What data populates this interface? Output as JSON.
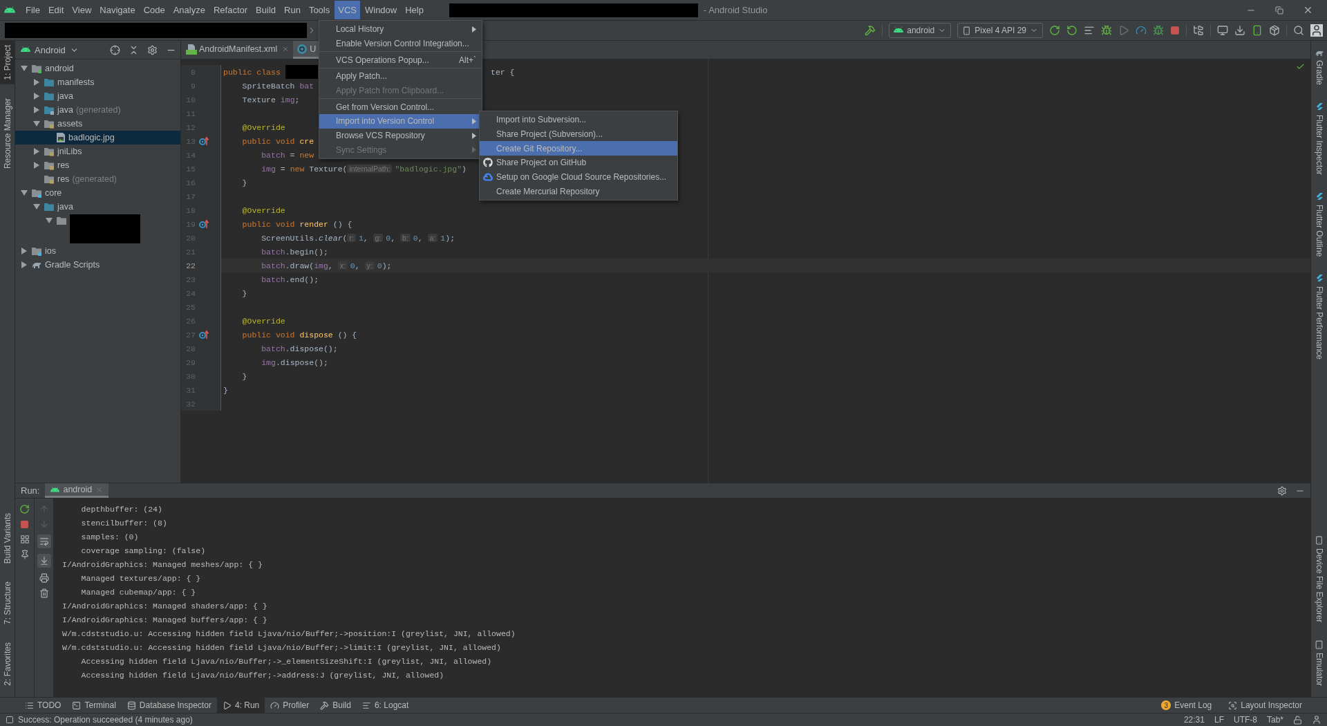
{
  "title_bar": {
    "title": "- Android Studio"
  },
  "menu_bar": [
    {
      "label": "File",
      "selected": false
    },
    {
      "label": "Edit",
      "selected": false
    },
    {
      "label": "View",
      "selected": false
    },
    {
      "label": "Navigate",
      "selected": false
    },
    {
      "label": "Code",
      "selected": false
    },
    {
      "label": "Analyze",
      "selected": false
    },
    {
      "label": "Refactor",
      "selected": false
    },
    {
      "label": "Build",
      "selected": false
    },
    {
      "label": "Run",
      "selected": false
    },
    {
      "label": "Tools",
      "selected": false
    },
    {
      "label": "VCS",
      "selected": true
    },
    {
      "label": "Window",
      "selected": false
    },
    {
      "label": "Help",
      "selected": false
    }
  ],
  "toolbar": {
    "run_config": "android",
    "device": "Pixel 4 API 29"
  },
  "left_tool_strip": {
    "top": [
      {
        "label": "1: Project",
        "selected": true
      },
      {
        "label": "Resource Manager",
        "selected": false
      }
    ],
    "bottom": [
      {
        "label": "Build Variants",
        "selected": false
      },
      {
        "label": "7: Structure",
        "selected": false
      },
      {
        "label": "2: Favorites",
        "selected": false
      }
    ]
  },
  "project_panel": {
    "view": "Android",
    "tree": [
      {
        "kind": "android-module",
        "label": "android",
        "expandable": true,
        "expanded": true,
        "selected": false,
        "children": [
          {
            "kind": "folder",
            "label": "manifests",
            "expandable": true,
            "expanded": false,
            "selected": false
          },
          {
            "kind": "folder",
            "label": "java",
            "expandable": true,
            "expanded": false,
            "selected": false
          },
          {
            "kind": "folder-generated",
            "label": "java",
            "note": "(generated)",
            "expandable": true,
            "expanded": false,
            "selected": false
          },
          {
            "kind": "res-folder",
            "label": "assets",
            "expandable": true,
            "expanded": true,
            "selected": false,
            "children": [
              {
                "kind": "image",
                "label": "badlogic.jpg",
                "expandable": false,
                "expanded": false,
                "selected": true
              }
            ]
          },
          {
            "kind": "res-folder",
            "label": "jniLibs",
            "expandable": true,
            "expanded": false,
            "selected": false
          },
          {
            "kind": "res-folder",
            "label": "res",
            "expandable": true,
            "expanded": false,
            "selected": false
          },
          {
            "kind": "res-folder",
            "label": "res",
            "note": "(generated)",
            "expandable": false,
            "expanded": false,
            "selected": false
          }
        ]
      },
      {
        "kind": "module",
        "label": "core",
        "expandable": true,
        "expanded": true,
        "selected": false,
        "children": [
          {
            "kind": "folder",
            "label": "java",
            "expandable": true,
            "expanded": true,
            "selected": false,
            "children": [
              {
                "kind": "package",
                "redacted": true,
                "expandable": true,
                "expanded": true,
                "selected": false
              }
            ]
          }
        ]
      },
      {
        "kind": "module",
        "label": "ios",
        "expandable": true,
        "expanded": false,
        "selected": false
      },
      {
        "kind": "gradle",
        "label": "Gradle Scripts",
        "expandable": true,
        "expanded": false,
        "selected": false
      }
    ]
  },
  "editor": {
    "tabs": [
      {
        "kind": "manifest",
        "label": "AndroidManifest.xml",
        "closable": true,
        "selected": false
      },
      {
        "kind": "class",
        "label": "U",
        "closable": false,
        "selected": true
      }
    ],
    "lines": [
      {
        "number": "8",
        "current": false,
        "override": false,
        "left": [
          {
            "kind": "kw",
            "text": "public class "
          },
          {
            "kind": "redacted"
          }
        ],
        "right": [
          {
            "kind": "plain",
            "text": "ter {"
          }
        ]
      },
      {
        "number": "9",
        "current": false,
        "override": false,
        "left": [
          {
            "kind": "plain",
            "text": "    SpriteBatch "
          },
          {
            "kind": "field",
            "text": "bat"
          }
        ]
      },
      {
        "number": "10",
        "current": false,
        "override": false,
        "left": [
          {
            "kind": "plain",
            "text": "    Texture "
          },
          {
            "kind": "field",
            "text": "img"
          },
          {
            "kind": "plain",
            "text": ";"
          }
        ]
      },
      {
        "number": "11",
        "current": false,
        "override": false
      },
      {
        "number": "12",
        "current": false,
        "override": false,
        "left": [
          {
            "kind": "annot",
            "text": "    @Override"
          }
        ]
      },
      {
        "number": "13",
        "current": false,
        "override": true,
        "left": [
          {
            "kind": "kw",
            "text": "    public void "
          },
          {
            "kind": "fn",
            "text": "cre"
          }
        ]
      },
      {
        "number": "14",
        "current": false,
        "override": false,
        "left": [
          {
            "kind": "field",
            "text": "        batch"
          },
          {
            "kind": "plain",
            "text": " = "
          },
          {
            "kind": "kw",
            "text": "new"
          }
        ]
      },
      {
        "number": "15",
        "current": false,
        "override": false,
        "left": [
          {
            "kind": "field",
            "text": "        img"
          },
          {
            "kind": "plain",
            "text": " = "
          },
          {
            "kind": "kw",
            "text": "new "
          },
          {
            "kind": "plain",
            "text": "Texture("
          },
          {
            "kind": "hint",
            "text": "internalPath:"
          },
          {
            "kind": "str",
            "text": "\"badlogic.jpg\""
          },
          {
            "kind": "plain",
            "text": ")"
          }
        ]
      },
      {
        "number": "16",
        "current": false,
        "override": false,
        "left": [
          {
            "kind": "plain",
            "text": "    }"
          }
        ]
      },
      {
        "number": "17",
        "current": false,
        "override": false
      },
      {
        "number": "18",
        "current": false,
        "override": false,
        "left": [
          {
            "kind": "annot",
            "text": "    @Override"
          }
        ]
      },
      {
        "number": "19",
        "current": false,
        "override": true,
        "left": [
          {
            "kind": "kw",
            "text": "    public void "
          },
          {
            "kind": "fn",
            "text": "render "
          },
          {
            "kind": "plain",
            "text": "() {"
          }
        ]
      },
      {
        "number": "20",
        "current": false,
        "override": false,
        "left": [
          {
            "kind": "plain",
            "text": "        ScreenUtils."
          },
          {
            "kind": "static",
            "text": "clear"
          },
          {
            "kind": "plain",
            "text": "("
          },
          {
            "kind": "hint",
            "text": "r:"
          },
          {
            "kind": "num",
            "text": "1"
          },
          {
            "kind": "plain",
            "text": ", "
          },
          {
            "kind": "hint",
            "text": "g:"
          },
          {
            "kind": "num",
            "text": "0"
          },
          {
            "kind": "plain",
            "text": ", "
          },
          {
            "kind": "hint",
            "text": "b:"
          },
          {
            "kind": "num",
            "text": "0"
          },
          {
            "kind": "plain",
            "text": ", "
          },
          {
            "kind": "hint",
            "text": "a:"
          },
          {
            "kind": "num",
            "text": "1"
          },
          {
            "kind": "plain",
            "text": ");"
          }
        ]
      },
      {
        "number": "21",
        "current": false,
        "override": false,
        "left": [
          {
            "kind": "field",
            "text": "        batch"
          },
          {
            "kind": "plain",
            "text": ".begin();"
          }
        ]
      },
      {
        "number": "22",
        "current": true,
        "override": false,
        "left": [
          {
            "kind": "field",
            "text": "        batch"
          },
          {
            "kind": "plain",
            "text": ".draw("
          },
          {
            "kind": "field",
            "text": "img"
          },
          {
            "kind": "plain",
            "text": ", "
          },
          {
            "kind": "hint",
            "text": "x:"
          },
          {
            "kind": "num",
            "text": "0"
          },
          {
            "kind": "plain",
            "text": ", "
          },
          {
            "kind": "hint",
            "text": "y:"
          },
          {
            "kind": "num",
            "text": "0"
          },
          {
            "kind": "plain",
            "text": ");"
          }
        ]
      },
      {
        "number": "23",
        "current": false,
        "override": false,
        "left": [
          {
            "kind": "field",
            "text": "        batch"
          },
          {
            "kind": "plain",
            "text": ".end();"
          }
        ]
      },
      {
        "number": "24",
        "current": false,
        "override": false,
        "left": [
          {
            "kind": "plain",
            "text": "    }"
          }
        ]
      },
      {
        "number": "25",
        "current": false,
        "override": false
      },
      {
        "number": "26",
        "current": false,
        "override": false,
        "left": [
          {
            "kind": "annot",
            "text": "    @Override"
          }
        ]
      },
      {
        "number": "27",
        "current": false,
        "override": true,
        "left": [
          {
            "kind": "kw",
            "text": "    public void "
          },
          {
            "kind": "fn",
            "text": "dispose "
          },
          {
            "kind": "plain",
            "text": "() {"
          }
        ]
      },
      {
        "number": "28",
        "current": false,
        "override": false,
        "left": [
          {
            "kind": "field",
            "text": "        batch"
          },
          {
            "kind": "plain",
            "text": ".dispose();"
          }
        ]
      },
      {
        "number": "29",
        "current": false,
        "override": false,
        "left": [
          {
            "kind": "field",
            "text": "        img"
          },
          {
            "kind": "plain",
            "text": ".dispose();"
          }
        ]
      },
      {
        "number": "30",
        "current": false,
        "override": false,
        "left": [
          {
            "kind": "plain",
            "text": "    }"
          }
        ]
      },
      {
        "number": "31",
        "current": false,
        "override": false,
        "left": [
          {
            "kind": "plain",
            "text": "}"
          }
        ]
      },
      {
        "number": "32",
        "current": false,
        "override": false
      }
    ]
  },
  "vcs_menu": {
    "items": [
      {
        "kind": "item",
        "label": "Local History",
        "submenu": true,
        "disabled": false,
        "selected": false
      },
      {
        "kind": "item",
        "label": "Enable Version Control Integration...",
        "submenu": false,
        "disabled": false,
        "selected": false
      },
      {
        "kind": "separator"
      },
      {
        "kind": "item",
        "label": "VCS Operations Popup...",
        "shortcut": "Alt+`",
        "submenu": false,
        "disabled": false,
        "selected": false
      },
      {
        "kind": "separator"
      },
      {
        "kind": "item",
        "label": "Apply Patch...",
        "submenu": false,
        "disabled": false,
        "selected": false
      },
      {
        "kind": "item",
        "label": "Apply Patch from Clipboard...",
        "submenu": false,
        "disabled": true,
        "selected": false
      },
      {
        "kind": "separator"
      },
      {
        "kind": "item",
        "label": "Get from Version Control...",
        "submenu": false,
        "disabled": false,
        "selected": false
      },
      {
        "kind": "item",
        "label": "Import into Version Control",
        "submenu": true,
        "disabled": false,
        "selected": true
      },
      {
        "kind": "item",
        "label": "Browse VCS Repository",
        "submenu": true,
        "disabled": false,
        "selected": false
      },
      {
        "kind": "item",
        "label": "Sync Settings",
        "submenu": true,
        "disabled": true,
        "selected": false
      }
    ]
  },
  "import_submenu": {
    "items": [
      {
        "kind": "plain",
        "label": "Import into Subversion...",
        "selected": false
      },
      {
        "kind": "plain",
        "label": "Share Project (Subversion)...",
        "selected": false
      },
      {
        "kind": "plain",
        "label": "Create Git Repository...",
        "selected": true
      },
      {
        "kind": "github",
        "label": "Share Project on GitHub",
        "selected": false
      },
      {
        "kind": "gcloud",
        "label": "Setup on Google Cloud Source Repositories...",
        "selected": false
      },
      {
        "kind": "plain",
        "label": "Create Mercurial Repository",
        "selected": false
      }
    ]
  },
  "run_panel": {
    "label": "Run:",
    "tabs": [
      {
        "label": "android",
        "selected": true
      }
    ],
    "console": [
      "    depthbuffer: (24)",
      "    stencilbuffer: (8)",
      "    samples: (0)",
      "    coverage sampling: (false)",
      "I/AndroidGraphics: Managed meshes/app: { }",
      "    Managed textures/app: { }",
      "    Managed cubemap/app: { }",
      "I/AndroidGraphics: Managed shaders/app: { }",
      "I/AndroidGraphics: Managed buffers/app: { }",
      "W/m.cdststudio.u: Accessing hidden field Ljava/nio/Buffer;->position:I (greylist, JNI, allowed)",
      "W/m.cdststudio.u: Accessing hidden field Ljava/nio/Buffer;->limit:I (greylist, JNI, allowed)",
      "    Accessing hidden field Ljava/nio/Buffer;->_elementSizeShift:I (greylist, JNI, allowed)",
      "    Accessing hidden field Ljava/nio/Buffer;->address:J (greylist, JNI, allowed)"
    ]
  },
  "right_tool_strip": {
    "top": [
      {
        "kind": "gradle",
        "label": "Gradle"
      },
      {
        "kind": "flutter",
        "label": "Flutter Inspector"
      },
      {
        "kind": "flutter",
        "label": "Flutter Outline"
      },
      {
        "kind": "flutter",
        "label": "Flutter Performance"
      }
    ],
    "bottom": [
      {
        "kind": "device",
        "label": "Device File Explorer"
      },
      {
        "kind": "emulator",
        "label": "Emulator"
      }
    ]
  },
  "bottom_tool_tabs": {
    "left": [
      {
        "kind": "todo",
        "label": "TODO",
        "selected": false
      },
      {
        "kind": "terminal",
        "label": "Terminal",
        "selected": false
      },
      {
        "kind": "database",
        "label": "Database Inspector",
        "selected": false
      },
      {
        "kind": "run",
        "label": "4: Run",
        "selected": true
      },
      {
        "kind": "profiler",
        "label": "Profiler",
        "selected": false
      },
      {
        "kind": "build",
        "label": "Build",
        "selected": false
      },
      {
        "kind": "logcat",
        "label": "6: Logcat",
        "selected": false
      }
    ],
    "right": [
      {
        "kind": "event-log",
        "label": "Event Log",
        "badge": "3"
      },
      {
        "kind": "layout-inspector",
        "label": "Layout Inspector"
      }
    ]
  },
  "status_bar": {
    "message": "Success: Operation succeeded (4 minutes ago)",
    "items": [
      "22:31",
      "LF",
      "UTF-8",
      "Tab*"
    ]
  }
}
